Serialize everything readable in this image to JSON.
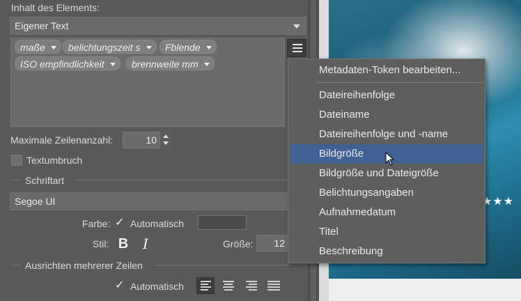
{
  "content": {
    "label": "Inhalt des Elements:",
    "content_type_value": "Eigener Text",
    "tokens": [
      "maße",
      "belichtungszeit s",
      "Fblende",
      "ISO empfindlichkeit",
      "brennweite mm"
    ]
  },
  "max_lines": {
    "label": "Maximale Zeilenanzahl:",
    "value": "10"
  },
  "word_wrap": {
    "label": "Textumbruch",
    "checked": false
  },
  "font": {
    "section_label": "Schriftart",
    "family_value": "Segoe UI",
    "color_label": "Farbe:",
    "auto_label": "Automatisch",
    "auto_checked": true,
    "style_label": "Stil:",
    "bold_glyph": "B",
    "italic_glyph": "I",
    "size_label": "Größe:",
    "size_value": "12"
  },
  "align": {
    "section_label": "Ausrichten mehrerer Zeilen",
    "auto_label": "Automatisch",
    "auto_checked": true
  },
  "menu": {
    "items": [
      "Metadaten-Token bearbeiten...",
      "Dateireihenfolge",
      "Dateiname",
      "Dateireihenfolge und -name",
      "Bildgröße",
      "Bildgröße und Dateigröße",
      "Belichtungsangaben",
      "Aufnahmedatum",
      "Titel",
      "Beschreibung"
    ],
    "highlighted_index": 4
  },
  "photo": {
    "rating_stars": "★★★"
  },
  "colors": {
    "highlight": "#3f6193",
    "panel": "#595959",
    "menu": "#5e5e5e"
  },
  "icons": {
    "menu_button": "hamburger-icon",
    "token_caret": "chevron-down-icon",
    "check": "checkmark-icon",
    "cursor": "mouse-pointer-icon"
  }
}
